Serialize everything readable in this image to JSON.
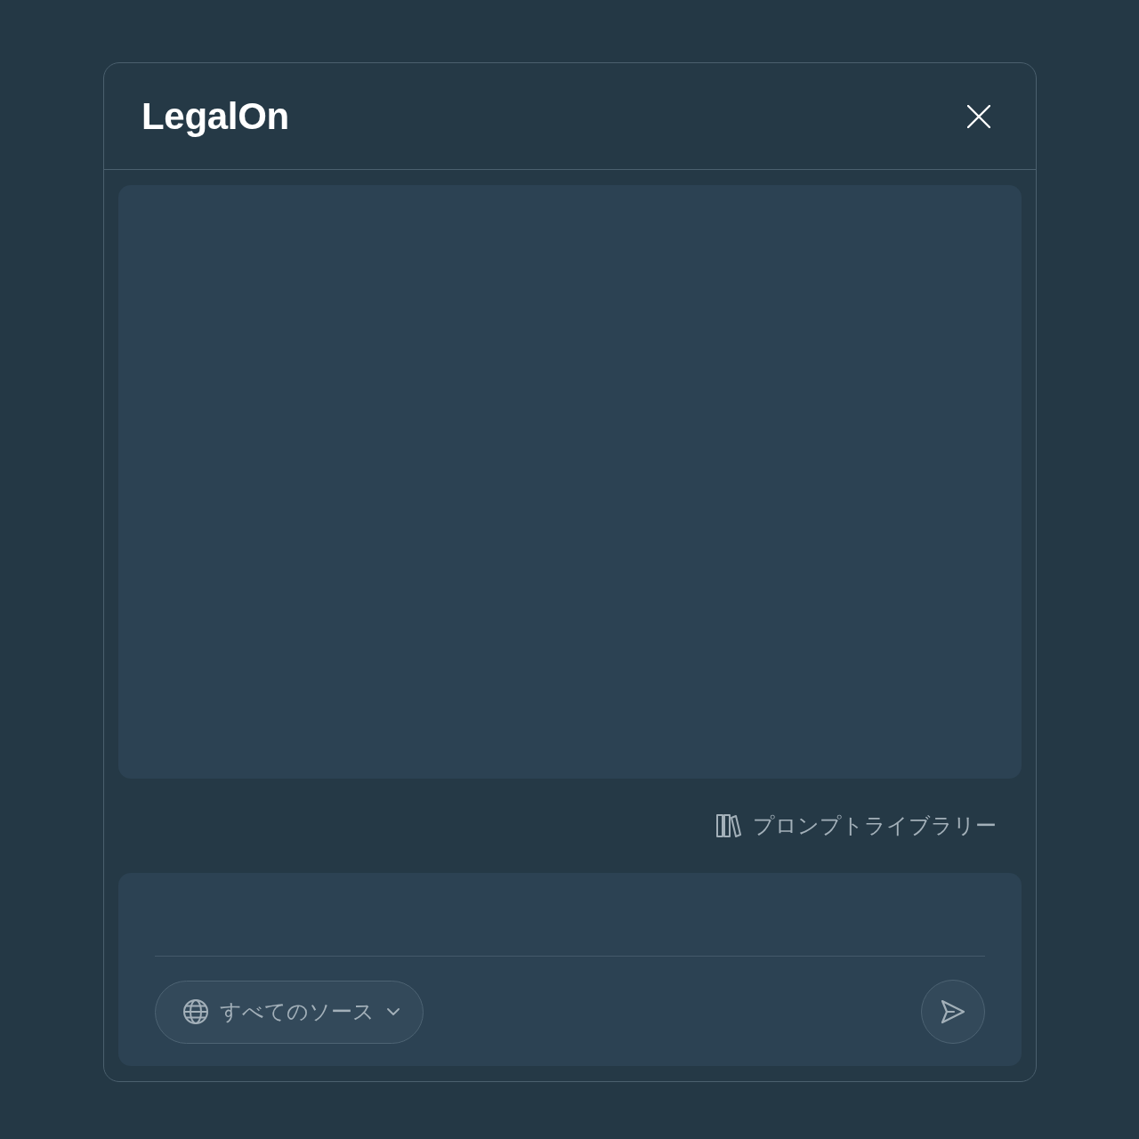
{
  "header": {
    "title": "LegalOn"
  },
  "prompt_library": {
    "label": "プロンプトライブラリー"
  },
  "composer": {
    "source_selector": {
      "label": "すべてのソース"
    }
  }
}
